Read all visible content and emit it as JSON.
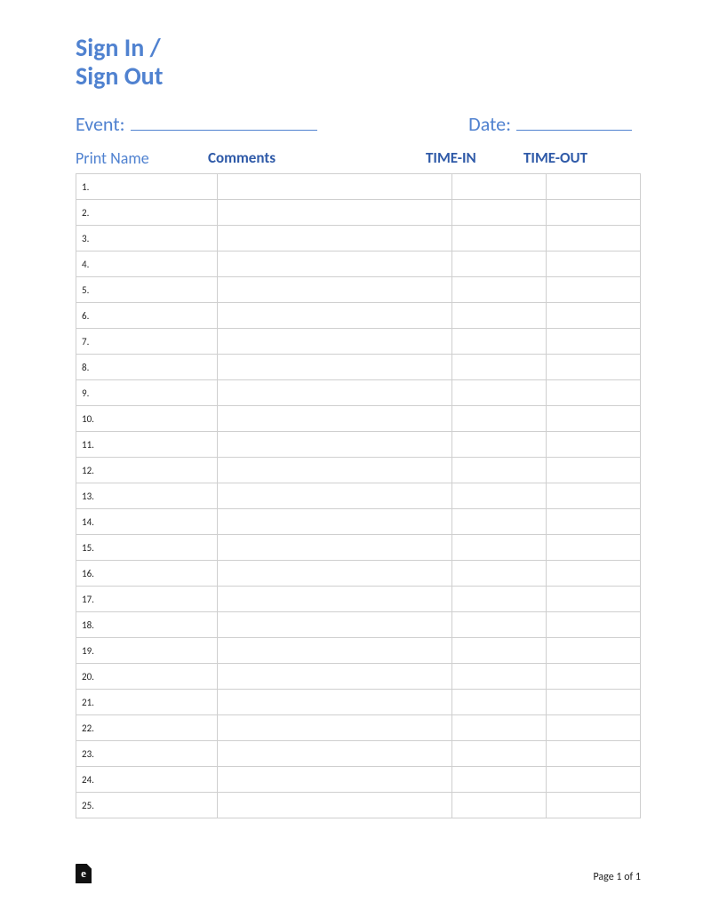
{
  "title_line1": "Sign In /",
  "title_line2": "Sign Out",
  "event_label": "Event:",
  "date_label": "Date:",
  "columns": {
    "print_name": "Print Name",
    "comments": "Comments",
    "time_in": "TIME-IN",
    "time_out": "TIME-OUT"
  },
  "rows": [
    "1.",
    "2.",
    "3.",
    "4.",
    "5.",
    "6.",
    "7.",
    "8.",
    "9.",
    "10.",
    "11.",
    "12.",
    "13.",
    "14.",
    "15.",
    "16.",
    "17.",
    "18.",
    "19.",
    "20.",
    "21.",
    "22.",
    "23.",
    "24.",
    "25."
  ],
  "footer": {
    "page_label": "Page 1 of 1"
  }
}
